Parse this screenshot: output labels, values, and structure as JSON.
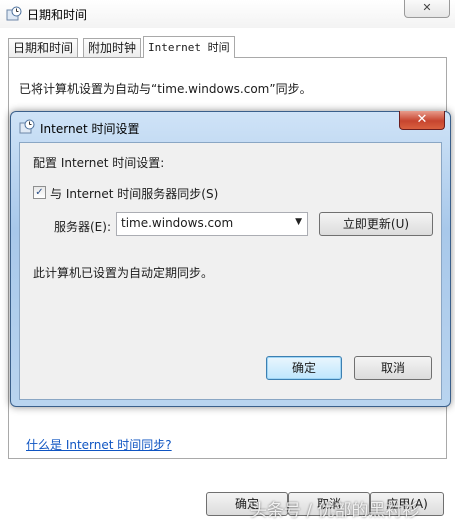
{
  "outer_window": {
    "title": "日期和时间",
    "close_glyph": "✕",
    "tabs": [
      {
        "label": "日期和时间"
      },
      {
        "label": "附加时钟"
      },
      {
        "label": "Internet 时间"
      }
    ],
    "panel_text": "已将计算机设置为自动与“time.windows.com”同步。",
    "link_text": "什么是 Internet 时间同步?",
    "buttons": {
      "ok": "确定",
      "cancel": "取消",
      "apply": "应用(A)"
    },
    "watermark": "头条号 / 优部的黑衬衫"
  },
  "dialog": {
    "title": "Internet 时间设置",
    "close_glyph": "✕",
    "heading": "配置 Internet 时间设置:",
    "sync_checkbox": {
      "label": "与 Internet 时间服务器同步(S)",
      "checked": true,
      "glyph": "✓"
    },
    "server": {
      "label": "服务器(E):",
      "value": "time.windows.com",
      "arrow": "▼"
    },
    "update_now_label": "立即更新(U)",
    "status_text": "此计算机已设置为自动定期同步。",
    "ok_label": "确定",
    "cancel_label": "取消"
  },
  "icons": {
    "window_icon": "clock-icon",
    "dialog_icon": "clock-icon"
  },
  "colors": {
    "dialog_frame": "#a8c8ea",
    "link": "#0f55c2",
    "close_red": "#c7452f"
  }
}
